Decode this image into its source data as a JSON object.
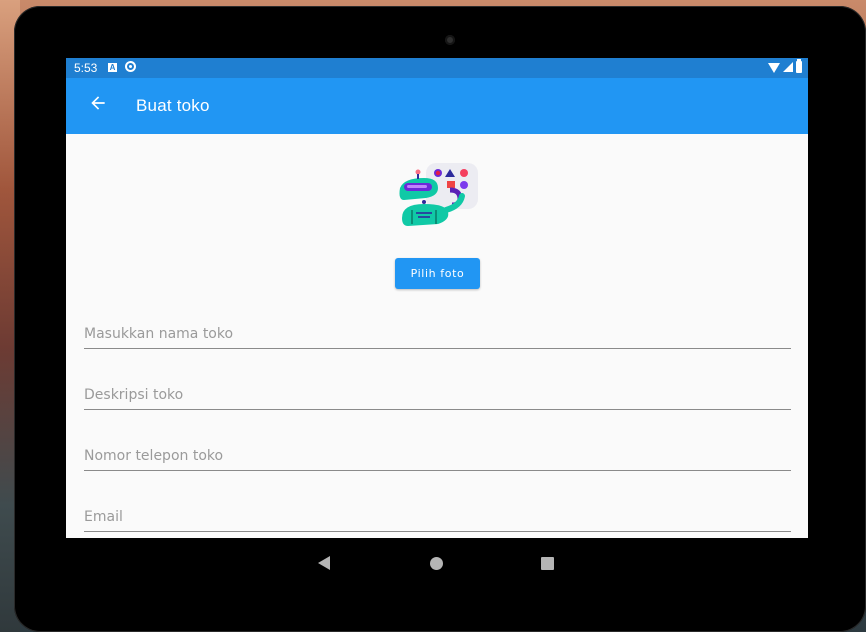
{
  "status_bar": {
    "time": "5:53",
    "icons": [
      "a-notification-icon",
      "sync-icon",
      "wifi-icon",
      "signal-icon",
      "battery-icon"
    ]
  },
  "app_bar": {
    "title": "Buat toko",
    "back_icon": "arrow-back-icon",
    "color": "#2196f3"
  },
  "form": {
    "pick_photo_label": "Pilih foto",
    "fields": [
      {
        "placeholder": "Masukkan nama toko",
        "value": ""
      },
      {
        "placeholder": "Deskripsi toko",
        "value": ""
      },
      {
        "placeholder": "Nomor telepon toko",
        "value": ""
      },
      {
        "placeholder": "Email",
        "value": ""
      }
    ]
  },
  "nav_bar": {
    "icons": [
      "nav-back-icon",
      "nav-home-icon",
      "nav-recents-icon"
    ]
  },
  "colors": {
    "accent": "#2196f3",
    "status_bar": "#1f7fd1"
  }
}
